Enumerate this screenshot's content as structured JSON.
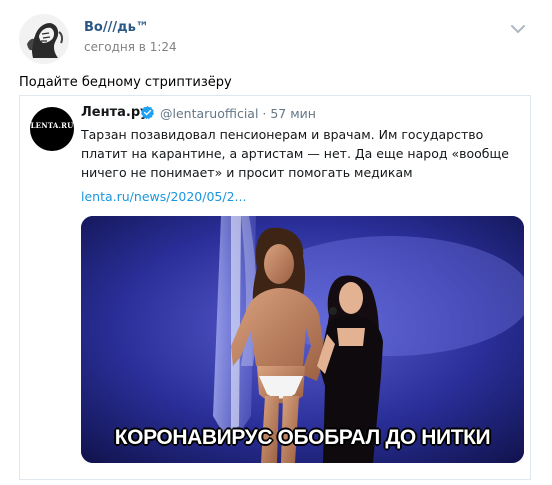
{
  "post": {
    "author": "Во///дь™",
    "time": "сегодня в 1:24",
    "text": "Подайте бедному стриптизёру"
  },
  "tweet": {
    "avatar_text": "LENTA.RU",
    "name": "Лента.ру",
    "handle": "@lentaruofficial · 57 мин",
    "body": "Тарзан позавидовал пенсионерам и врачам. Им государство платит на карантине, а артистам — нет. Да еще народ «вообще ничего не понимает» и просит помогать медикам",
    "link": "lenta.ru/news/2020/05/2...",
    "image_caption": "КОРОНАВИРУС ОБОБРАЛ ДО НИТКИ"
  },
  "icons": {
    "menu": "chevron-down-icon",
    "verified": "verified-badge-icon"
  },
  "colors": {
    "author_link": "#2a5885",
    "tweet_link": "#1b95e0",
    "verified": "#1da1f2"
  }
}
